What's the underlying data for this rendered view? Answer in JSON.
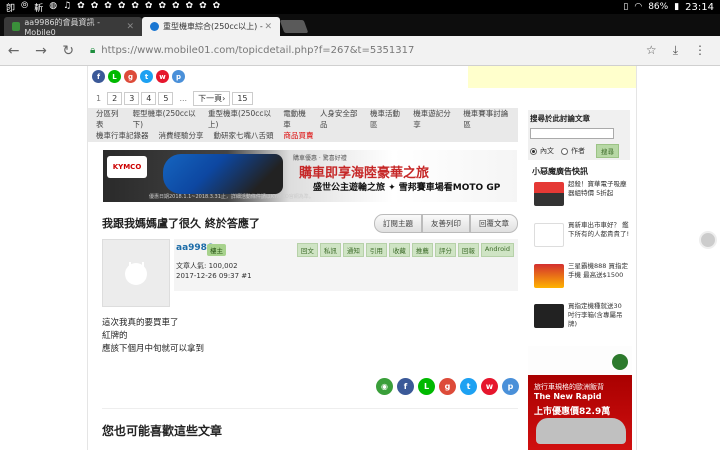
{
  "statusbar": {
    "icons": [
      "卽",
      "⦾",
      "斬",
      "◍",
      "♫",
      "✿",
      "✿",
      "✿",
      "✿",
      "✿",
      "✿",
      "✿",
      "✿",
      "✿",
      "✿",
      "✿"
    ],
    "battery": "86%",
    "time": "23:14"
  },
  "tabs": [
    {
      "title": "aa9986的會員資訊 - Mobile0",
      "favicon_color": "#3a8f3a"
    },
    {
      "title": "重型機車綜合(250cc以上) - ",
      "favicon_color": "#1976d2"
    }
  ],
  "toolbar": {
    "url": "https://www.mobile01.com/topicdetail.php?f=267&t=5351317"
  },
  "pager": {
    "pages": [
      "1",
      "2",
      "3",
      "4",
      "5"
    ],
    "ellipsis": "...",
    "next": "下一頁›",
    "last": "15"
  },
  "catnav": {
    "row1": [
      "分區列表",
      "輕型機車(250cc以下)",
      "重型機車(250cc以上)",
      "電動機車",
      "人身安全部品",
      "機車活動區",
      "機車遊記分享",
      "機車賽事討論區"
    ],
    "row2": [
      "機車行車記錄器",
      "消費經驗分享",
      "動研家七嘴八舌頭"
    ],
    "highlight": "商品買賣"
  },
  "banner": {
    "logo": "KYMCO",
    "small": "購車優惠 · 驚喜好禮",
    "headline": "購車即享海陸豪華之旅",
    "sub": "盛世公主遊輪之旅 ✦ 雪邦賽車場看MOTO GP",
    "fine": "優惠日期2018.1.1~2018.3.31止，詳細活動條件請以KYMCO官網為準。"
  },
  "post": {
    "title": "我跟我媽媽盧了很久 終於答應了",
    "buttons": [
      "訂閱主題",
      "友善列印",
      "回覆文章"
    ],
    "username": "aa9986",
    "badge": "樓主",
    "views": "文章人氣: 100,002",
    "datetime": "2017-12-26 09:37  #1",
    "actions": [
      "回文",
      "私訊",
      "通知",
      "引用",
      "收藏",
      "推薦",
      "評分",
      "回報",
      "Android"
    ],
    "body": [
      "這次我真的要買車了",
      "紅牌的",
      "應該下個月中旬就可以拿到"
    ]
  },
  "related_title": "您也可能喜歡這些文章",
  "sidebar": {
    "search_title": "搜尋於此討論文章",
    "opt1": "內文",
    "opt2": "作者",
    "search_btn": "搜尋",
    "ads_title": "小惡魔廣告快訊",
    "ads": [
      {
        "text": "超殺！寶華電子吸塵器組特價 5折起"
      },
      {
        "text": "買新車出市車好？ 鑑下所有的人都貴貴了!"
      },
      {
        "text": "三星霸機888 買指定手機 最高送$1500"
      },
      {
        "text": "買指定機種就送30 吋行李箱(含專屬吊牌)"
      }
    ],
    "skoda_line1": "旅行車規格的歐洲飯背",
    "skoda_line2": "The New Rapid",
    "skoda_line3": "上市優惠價82.9萬"
  }
}
